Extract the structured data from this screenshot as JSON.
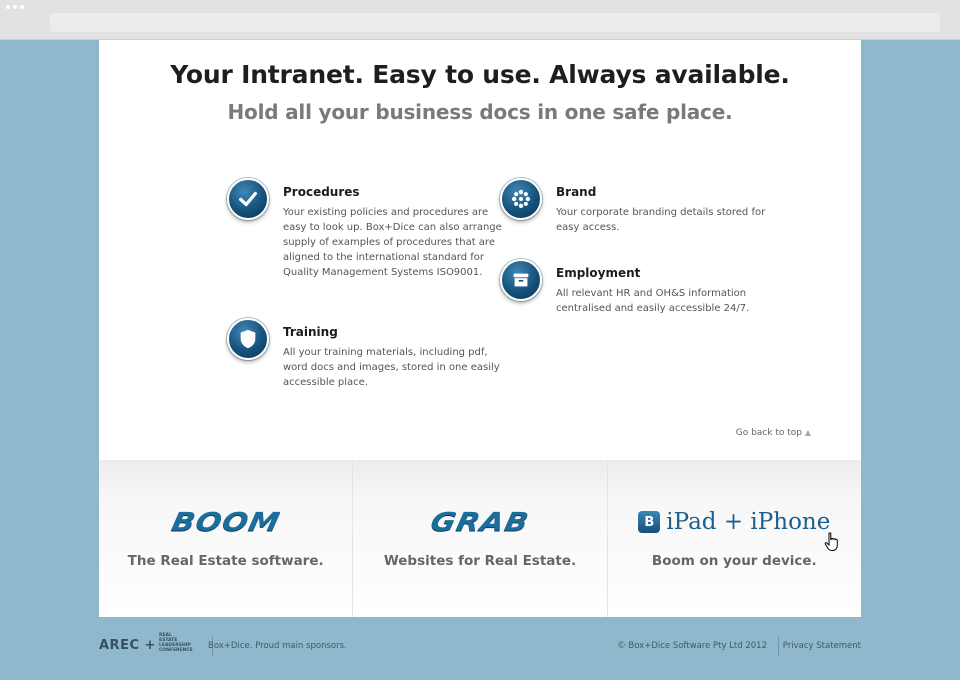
{
  "hero": {
    "headline": "Your Intranet. Easy to use. Always available.",
    "subhead": "Hold all your business docs in one safe place."
  },
  "features": [
    {
      "title": "Procedures",
      "icon": "checkmark-icon",
      "text": "Your existing policies and procedures are easy to look up. Box+Dice can also arrange supply of examples of procedures that are aligned to the international standard for Quality Management Systems ISO9001."
    },
    {
      "title": "Training",
      "icon": "shield-icon",
      "text": "All your training materials, including pdf, word docs and images, stored in one easily accessible place."
    },
    {
      "title": "Brand",
      "icon": "asterisk-flower-icon",
      "text": "Your corporate branding details stored for easy access."
    },
    {
      "title": "Employment",
      "icon": "archive-box-icon",
      "text": "All relevant HR and OH&S information centralised and easily accessible 24/7."
    }
  ],
  "go_top": {
    "label": "Go back to top",
    "arrow": "▲"
  },
  "products": [
    {
      "logo": "BOOM",
      "tagline": "The Real Estate software."
    },
    {
      "logo": "GRAB",
      "tagline": "Websites for Real Estate."
    },
    {
      "logo_badge": "B",
      "logo": "iPad + iPhone",
      "tagline": "Boom on your device."
    }
  ],
  "footer": {
    "arec": "AREC +",
    "arec_small": [
      "REAL",
      "ESTATE",
      "LEADERSHIP",
      "CONFERENCE"
    ],
    "sponsors": "Box+Dice. Proud main sponsors.",
    "copyright": "© Box+Dice Software Pty Ltd 2012",
    "privacy": "Privacy Statement"
  },
  "colors": {
    "background": "#8fb8cc",
    "icon_blue": "#16527c",
    "logo_blue": "#1c6d9c"
  }
}
